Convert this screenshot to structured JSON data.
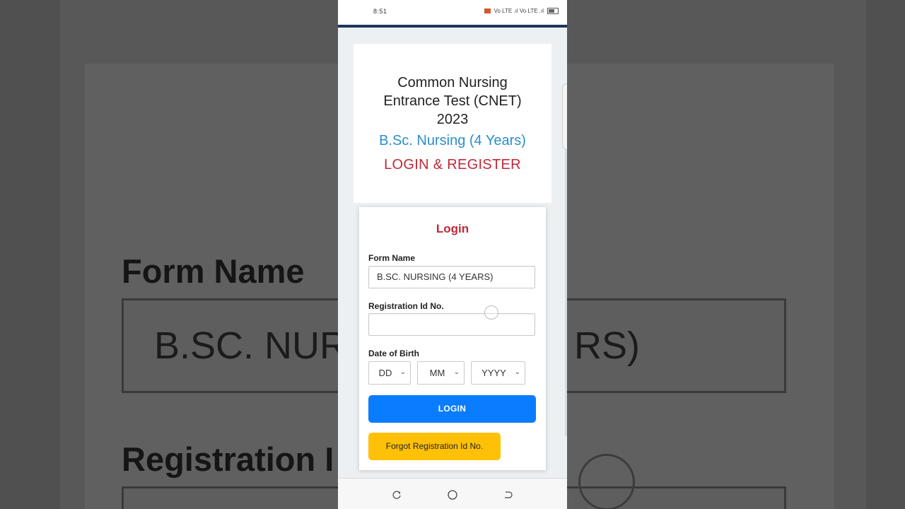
{
  "status_bar": {
    "time": "8:51",
    "indicators": "Vo LTE .ıl  Vo LTE .ıl"
  },
  "header": {
    "title": "Common Nursing Entrance Test (CNET) 2023",
    "subtitle": "B.Sc. Nursing (4 Years)",
    "register_line": "LOGIN & REGISTER"
  },
  "login_form": {
    "heading": "Login",
    "form_name_label": "Form Name",
    "form_name_value": "B.SC. NURSING (4 YEARS)",
    "registration_label": "Registration Id No.",
    "registration_value": "",
    "dob_label": "Date of Birth",
    "dob_day": "DD",
    "dob_month": "MM",
    "dob_year": "YYYY",
    "login_button": "LOGIN",
    "forgot_button": "Forgot Registration Id No."
  },
  "background_zoom": {
    "form_name_label": "Form Name",
    "value_start": "B.SC. NUR",
    "value_end": "RS)",
    "registration_label": "Registration I"
  },
  "colors": {
    "accent_red": "#c0283a",
    "accent_blue": "#2b8fc9",
    "login_button": "#0a7cff",
    "forgot_button": "#ffc107",
    "top_rule": "#1d3557"
  },
  "icons": [
    "recent-apps-icon",
    "home-icon",
    "back-icon",
    "cast-icon",
    "battery-icon"
  ]
}
